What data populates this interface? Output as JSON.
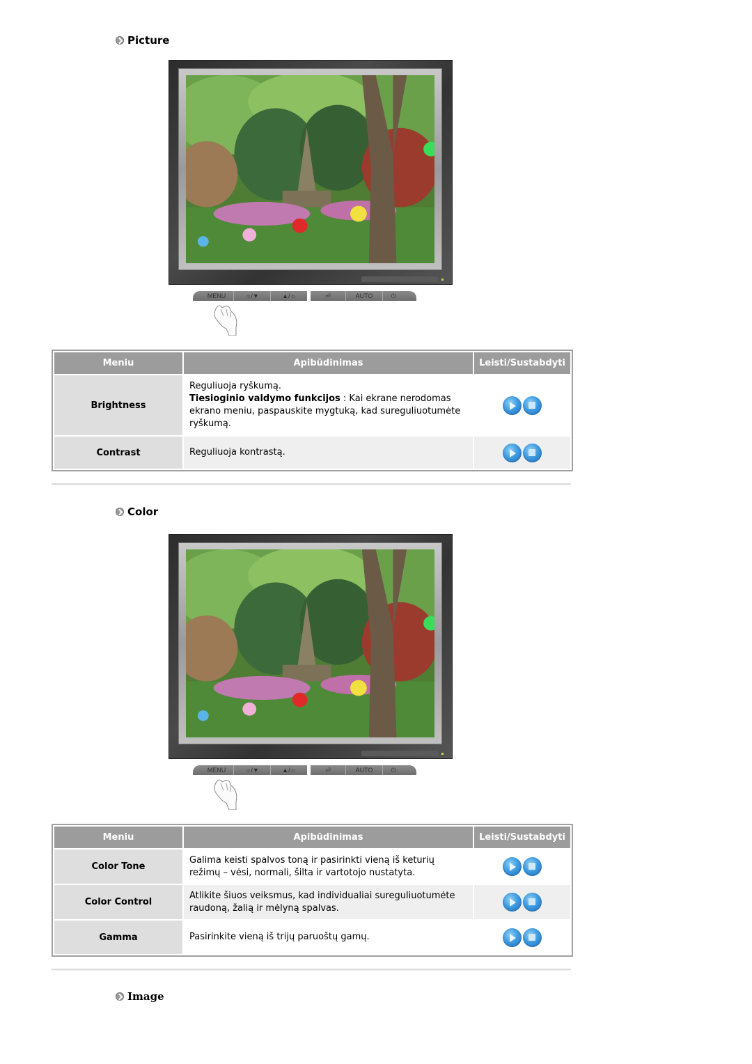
{
  "sections": [
    {
      "title": "Picture",
      "table": {
        "headers": [
          "Meniu",
          "Apibūdinimas",
          "Leisti/Sustabdyti"
        ],
        "rows": [
          {
            "name": "Brightness",
            "desc_line1": "Reguliuoja ryškumą.",
            "desc_bold": "Tiesioginio valdymo funkcijos",
            "desc_rest": " : Kai ekrane nerodomas ekrano meniu, paspauskite mygtuką, kad sureguliuotumėte ryškumą."
          },
          {
            "name": "Contrast",
            "desc_line1": "Reguliuoja kontrastą."
          }
        ]
      }
    },
    {
      "title": "Color",
      "table": {
        "headers": [
          "Meniu",
          "Apibūdinimas",
          "Leisti/Sustabdyti"
        ],
        "rows": [
          {
            "name": "Color Tone",
            "desc_line1": "Galima keisti spalvos toną ir pasirinkti vieną iš keturių režimų – vėsi, normali, šilta ir vartotojo nustatyta."
          },
          {
            "name": "Color Control",
            "desc_line1": "Atlikite šiuos veiksmus, kad individualiai sureguliuotumėte raudoną, žalią ir mėlyną spalvas."
          },
          {
            "name": "Gamma",
            "desc_line1": "Pasirinkite vieną iš trijų paruoštų gamų."
          }
        ]
      }
    },
    {
      "title": "Image"
    }
  ],
  "monitor_controls": [
    "MENU",
    "☼/▼",
    "▲/☼",
    "⏎",
    "AUTO",
    "⏻"
  ],
  "play_buttons": {
    "play": "play-icon",
    "stop": "stop-icon"
  },
  "colors": {
    "header_bg": "#9c9c9c",
    "name_cell_bg": "#dedede",
    "alt_row_bg": "#efefef",
    "button_blue": "#3f9be0"
  }
}
